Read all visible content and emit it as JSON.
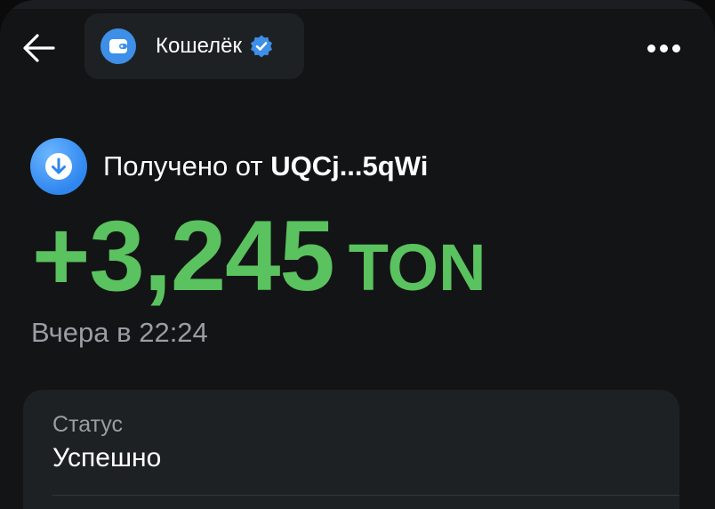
{
  "header": {
    "back_icon": "arrow-left-icon",
    "title": "Кошелёк",
    "avatar_icon": "wallet-icon",
    "verified_icon": "verified-badge-icon",
    "more_icon": "more-horizontal-icon"
  },
  "transaction": {
    "direction_icon": "arrow-down-icon",
    "label": "Получено от",
    "address": "UQCj...5qWi",
    "amount": "+3,245",
    "currency": "TON",
    "date": "Вчера в 22:24"
  },
  "details": {
    "status_label": "Статус",
    "status_value": "Успешно"
  },
  "colors": {
    "background": "#131416",
    "card": "#1e2124",
    "accent_blue": "#3d8fe8",
    "amount_green": "#5ac25e",
    "secondary_text": "#9a9da2"
  }
}
